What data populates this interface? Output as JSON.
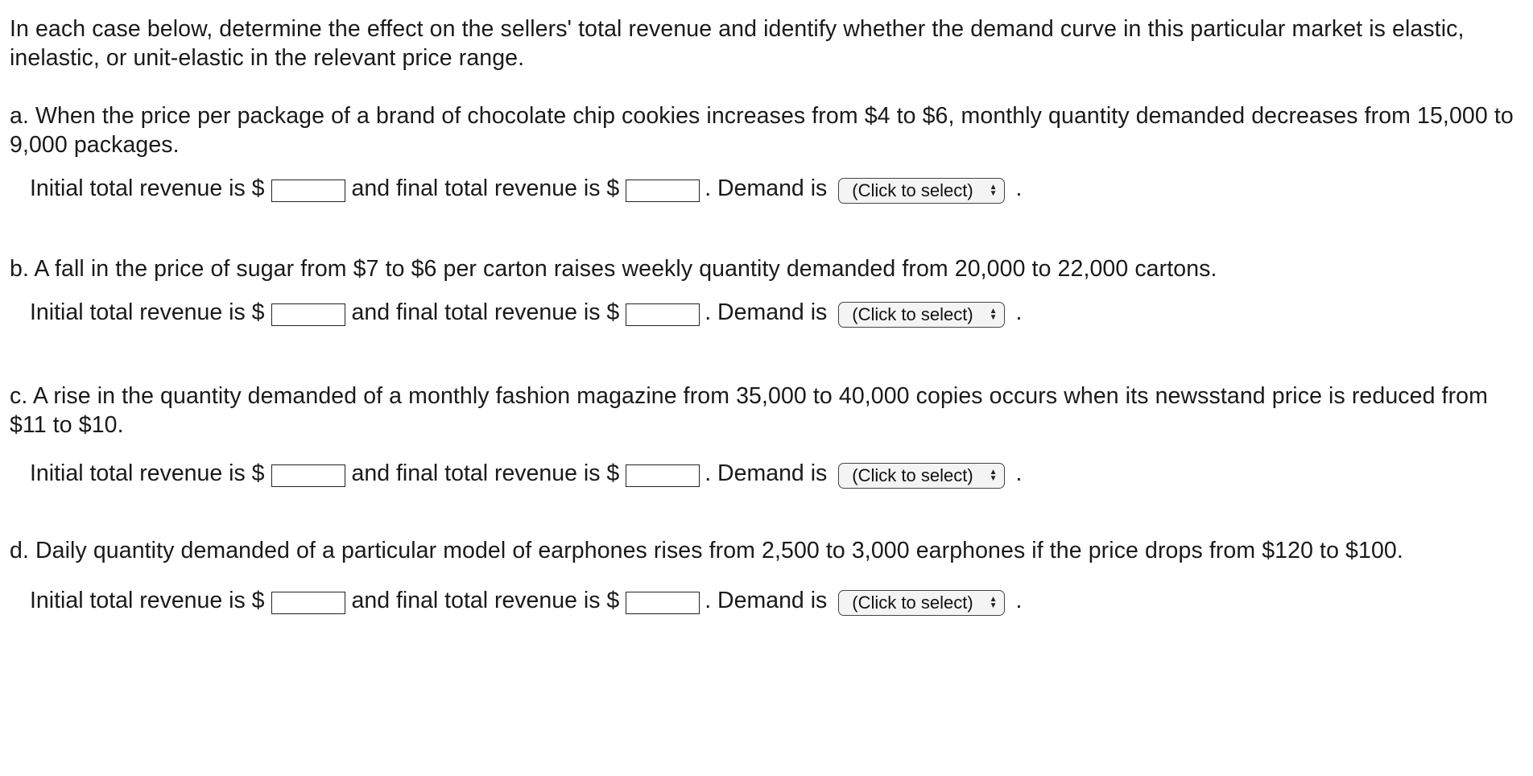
{
  "intro": "In each case below, determine the effect on the sellers' total revenue and identify whether the demand curve in this particular market is elastic, inelastic, or unit-elastic in the relevant price range.",
  "common": {
    "initial_label": "Initial total revenue is $",
    "final_label": "and final total revenue is $",
    "demand_label": ". Demand is",
    "select_placeholder": "(Click to select)",
    "trailing_period": "."
  },
  "questions": [
    {
      "text": "a. When the price per package of a brand of chocolate chip cookies increases from $4 to $6, monthly quantity demanded decreases from 15,000 to 9,000 packages.",
      "initial_value": "",
      "final_value": "",
      "demand_value": "(Click to select)"
    },
    {
      "text": "b. A fall in the price of sugar from $7 to $6 per carton raises weekly quantity demanded from 20,000 to 22,000 cartons.",
      "initial_value": "",
      "final_value": "",
      "demand_value": "(Click to select)"
    },
    {
      "text": "c. A rise in the quantity demanded of a monthly fashion magazine from 35,000 to 40,000 copies occurs when its newsstand price is reduced from $11 to $10.",
      "initial_value": "",
      "final_value": "",
      "demand_value": "(Click to select)"
    },
    {
      "text": "d. Daily quantity demanded of a particular model of earphones rises from 2,500 to 3,000 earphones if the price drops from $120 to $100.",
      "initial_value": "",
      "final_value": "",
      "demand_value": "(Click to select)"
    }
  ],
  "icons": {
    "select_arrows": "up-down-chevron-icon"
  }
}
